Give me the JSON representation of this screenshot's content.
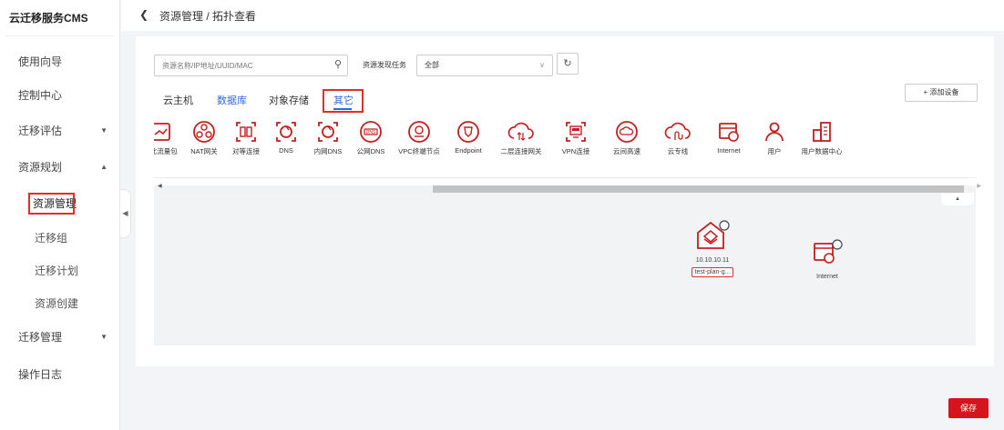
{
  "brand": "云迁移服务CMS",
  "sidebar": {
    "items": [
      {
        "label": "使用向导",
        "arrow": ""
      },
      {
        "label": "控制中心",
        "arrow": ""
      },
      {
        "label": "迁移评估",
        "arrow": "▼"
      },
      {
        "label": "资源规划",
        "arrow": "▲"
      },
      {
        "label": "资源管理",
        "arrow": ""
      },
      {
        "label": "迁移组",
        "arrow": ""
      },
      {
        "label": "迁移计划",
        "arrow": ""
      },
      {
        "label": "资源创建",
        "arrow": ""
      },
      {
        "label": "迁移管理",
        "arrow": "▼"
      },
      {
        "label": "操作日志",
        "arrow": ""
      }
    ]
  },
  "header": {
    "breadcrumb": "资源管理 / 拓扑查看"
  },
  "search": {
    "placeholder": "资源名称/IP地址/UUID/MAC"
  },
  "filter": {
    "label": "资源发现任务",
    "value": "全部"
  },
  "tabs": [
    "云主机",
    "数据库",
    "对象存储",
    "其它"
  ],
  "add_button": "+ 添加设备",
  "palette": [
    {
      "label": "南北流量包",
      "icon": "flow-package-icon"
    },
    {
      "label": "NAT网关",
      "icon": "nat-gateway-icon"
    },
    {
      "label": "对等连接",
      "icon": "peering-icon"
    },
    {
      "label": "DNS",
      "icon": "dns-icon"
    },
    {
      "label": "内网DNS",
      "icon": "private-dns-icon"
    },
    {
      "label": "公网DNS",
      "icon": "public-dns-icon"
    },
    {
      "label": "VPC终端节点",
      "icon": "vpc-endpoint-icon"
    },
    {
      "label": "Endpoint",
      "icon": "endpoint-icon"
    },
    {
      "label": "二层连接网关",
      "icon": "l2-gateway-icon"
    },
    {
      "label": "VPN连接",
      "icon": "vpn-icon"
    },
    {
      "label": "云间高速",
      "icon": "cloud-connect-icon"
    },
    {
      "label": "云专线",
      "icon": "direct-connect-icon"
    },
    {
      "label": "Internet",
      "icon": "internet-icon"
    },
    {
      "label": "用户",
      "icon": "user-icon"
    },
    {
      "label": "用户数据中心",
      "icon": "user-datacenter-icon"
    }
  ],
  "canvas_nodes": [
    {
      "ip": "10.10.10.11",
      "name": "test-plan-g...",
      "icon": "resource-node-icon"
    },
    {
      "ip": "",
      "name": "Internet",
      "icon": "internet-icon"
    }
  ],
  "save_button": "保存",
  "colors": {
    "accent": "#2b6be0",
    "highlight": "#e0302a",
    "save": "#d6141d",
    "icon": "#c21e1e"
  }
}
